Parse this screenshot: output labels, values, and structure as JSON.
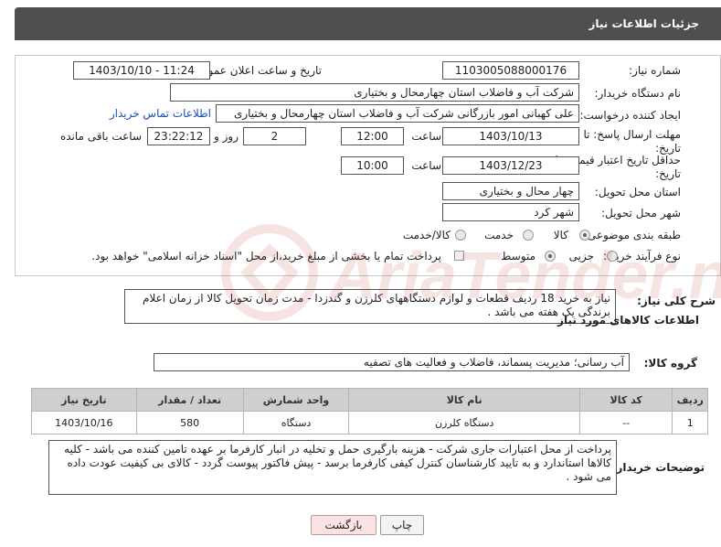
{
  "header": {
    "title": "جزئیات اطلاعات نیاز"
  },
  "fields": {
    "need_number_label": "شماره نیاز:",
    "need_number": "1103005088000176",
    "announce_label": "تاریخ و ساعت اعلان عمومی:",
    "announce_value": "1403/10/10 - 11:24",
    "buyer_org_label": "نام دستگاه خریدار:",
    "buyer_org": "شرکت آب و فاضلاب استان چهارمحال و بختیاری",
    "requester_label": "ایجاد کننده درخواست:",
    "requester": "علی کهبانی امور بازرگانی شرکت آب و فاضلاب استان چهارمحال و بختیاری",
    "contact_link": "اطلاعات تماس خریدار",
    "deadline_label_1": "مهلت ارسال پاسخ: تا",
    "deadline_label_2": "تاریخ:",
    "deadline_date": "1403/10/13",
    "time_label": "ساعت",
    "deadline_time": "12:00",
    "days_value": "2",
    "days_label": "روز و",
    "remaining_time": "23:22:12",
    "remaining_label": "ساعت باقی مانده",
    "validity_label_1": "حداقل تاریخ اعتبار قیمت: تا",
    "validity_label_2": "تاریخ:",
    "validity_date": "1403/12/23",
    "validity_time": "10:00",
    "province_label": "استان محل تحویل:",
    "province": "چهار محال و بختیاری",
    "city_label": "شهر محل تحویل:",
    "city": "شهر کرد",
    "category_label": "طبقه بندی موضوعی:",
    "category_options": [
      "کالا",
      "خدمت",
      "کالا/خدمت"
    ],
    "process_label": "نوع فرآیند خرید :",
    "process_options": [
      "جزیی",
      "متوسط"
    ],
    "payment_note": "پرداخت تمام یا بخشی از مبلغ خرید،از محل \"اسناد خزانه اسلامی\" خواهد بود."
  },
  "description": {
    "label": "شرح کلی نیاز:",
    "text": "نیاز به خرید 18 ردیف قطعات و لوازم دستگاههای کلرزن و گندزدا - مدت زمان تحویل کالا از زمان اعلام برندگی یک هفته می باشد ."
  },
  "goods_info_title": "اطلاعات کالاهای مورد نیاز",
  "goods_group": {
    "label": "گروه کالا:",
    "value": "آب رسانی؛ مدیریت پسماند، فاضلاب و فعالیت های تصفیه"
  },
  "table": {
    "headers": [
      "ردیف",
      "کد کالا",
      "نام کالا",
      "واحد شمارش",
      "تعداد / مقدار",
      "تاریخ نیاز"
    ],
    "rows": [
      [
        "1",
        "--",
        "دستگاه کلرزن",
        "دستگاه",
        "580",
        "1403/10/16"
      ]
    ]
  },
  "buyer_notes": {
    "label": "توضیحات خریدار:",
    "text": "پرداخت از محل اعتبارات جاری شرکت - هزینه بارگیری حمل و تخلیه در انبار کارفرما بر عهده تامین کننده می باشد - کلیه کالاها استاندارد و به تایید کارشناسان کنترل کیفی کارفرما برسد - پیش فاکتور پیوست گردد - کالای بی کیفیت عودت داده می شود ."
  },
  "buttons": {
    "print": "چاپ",
    "back": "بازگشت"
  },
  "watermark_text": "AriaTender.neT",
  "colors": {
    "header_bg": "#4f4f4f",
    "link": "#1a4fb8",
    "watermark": "#c0392b"
  }
}
